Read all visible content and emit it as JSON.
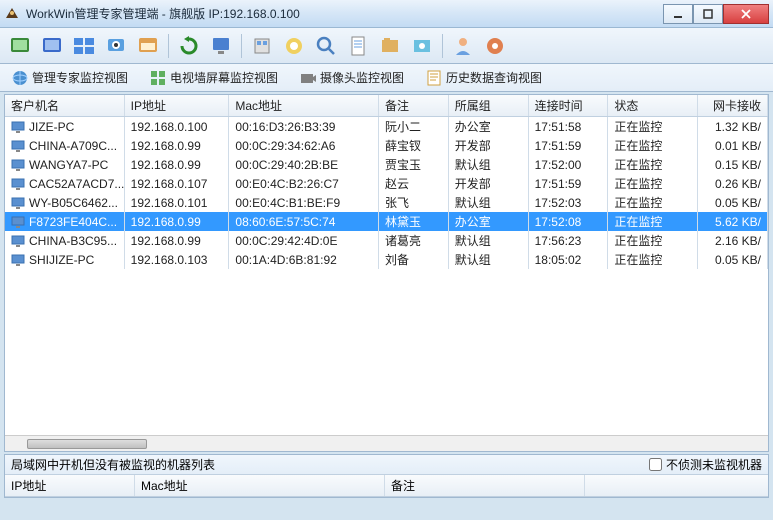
{
  "window": {
    "title": "WorkWin管理专家管理端 - 旗舰版 IP:192.168.0.100"
  },
  "tabs": [
    {
      "label": "管理专家监控视图"
    },
    {
      "label": "电视墙屏幕监控视图"
    },
    {
      "label": "摄像头监控视图"
    },
    {
      "label": "历史数据查询视图"
    }
  ],
  "columns": {
    "name": "客户机名",
    "ip": "IP地址",
    "mac": "Mac地址",
    "note": "备注",
    "group": "所属组",
    "time": "连接时间",
    "status": "状态",
    "bw": "网卡接收"
  },
  "rows": [
    {
      "name": "JIZE-PC",
      "ip": "192.168.0.100",
      "mac": "00:16:D3:26:B3:39",
      "note": "阮小二",
      "group": "办公室",
      "time": "17:51:58",
      "status": "正在监控",
      "bw": "1.32 KB/",
      "selected": false
    },
    {
      "name": "CHINA-A709C...",
      "ip": "192.168.0.99",
      "mac": "00:0C:29:34:62:A6",
      "note": "薛宝钗",
      "group": "开发部",
      "time": "17:51:59",
      "status": "正在监控",
      "bw": "0.01 KB/",
      "selected": false
    },
    {
      "name": "WANGYA7-PC",
      "ip": "192.168.0.99",
      "mac": "00:0C:29:40:2B:BE",
      "note": "贾宝玉",
      "group": "默认组",
      "time": "17:52:00",
      "status": "正在监控",
      "bw": "0.15 KB/",
      "selected": false
    },
    {
      "name": "CAC52A7ACD7...",
      "ip": "192.168.0.107",
      "mac": "00:E0:4C:B2:26:C7",
      "note": "赵云",
      "group": "开发部",
      "time": "17:51:59",
      "status": "正在监控",
      "bw": "0.26 KB/",
      "selected": false
    },
    {
      "name": "WY-B05C6462...",
      "ip": "192.168.0.101",
      "mac": "00:E0:4C:B1:BE:F9",
      "note": "张飞",
      "group": "默认组",
      "time": "17:52:03",
      "status": "正在监控",
      "bw": "0.05 KB/",
      "selected": false
    },
    {
      "name": "F8723FE404C...",
      "ip": "192.168.0.99",
      "mac": "08:60:6E:57:5C:74",
      "note": "林黛玉",
      "group": "办公室",
      "time": "17:52:08",
      "status": "正在监控",
      "bw": "5.62 KB/",
      "selected": true
    },
    {
      "name": "CHINA-B3C95...",
      "ip": "192.168.0.99",
      "mac": "00:0C:29:42:4D:0E",
      "note": "诸葛亮",
      "group": "默认组",
      "time": "17:56:23",
      "status": "正在监控",
      "bw": "2.16 KB/",
      "selected": false
    },
    {
      "name": "SHIJIZE-PC",
      "ip": "192.168.0.103",
      "mac": "00:1A:4D:6B:81:92",
      "note": "刘备",
      "group": "默认组",
      "time": "18:05:02",
      "status": "正在监控",
      "bw": "0.05 KB/",
      "selected": false
    }
  ],
  "bottom": {
    "title": "局域网中开机但没有被监视的机器列表",
    "checkbox": "不侦测未监视机器",
    "cols": {
      "ip": "IP地址",
      "mac": "Mac地址",
      "note": "备注"
    }
  }
}
